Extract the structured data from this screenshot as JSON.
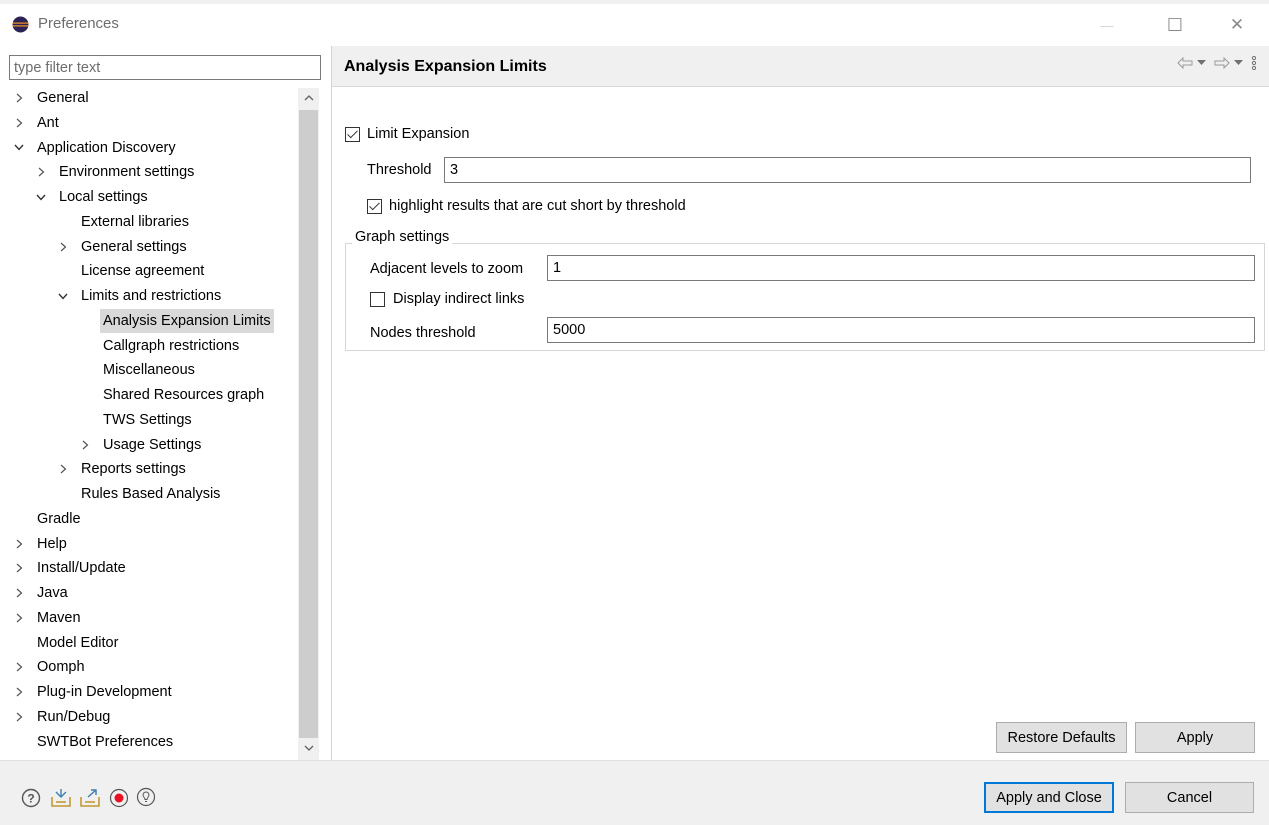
{
  "window": {
    "title": "Preferences",
    "controls": {
      "minimize": "—",
      "maximize": "☐",
      "close": "✕"
    }
  },
  "sidebar": {
    "filter_placeholder": "type filter text",
    "items": [
      {
        "label": "General",
        "level": 0,
        "arrow": "collapsed"
      },
      {
        "label": "Ant",
        "level": 0,
        "arrow": "collapsed"
      },
      {
        "label": "Application Discovery",
        "level": 0,
        "arrow": "expanded"
      },
      {
        "label": "Environment settings",
        "level": 1,
        "arrow": "collapsed"
      },
      {
        "label": "Local settings",
        "level": 1,
        "arrow": "expanded"
      },
      {
        "label": "External libraries",
        "level": 2,
        "arrow": "none"
      },
      {
        "label": "General settings",
        "level": 2,
        "arrow": "collapsed"
      },
      {
        "label": "License agreement",
        "level": 2,
        "arrow": "none"
      },
      {
        "label": "Limits and restrictions",
        "level": 2,
        "arrow": "expanded"
      },
      {
        "label": "Analysis Expansion Limits",
        "level": 3,
        "arrow": "none",
        "selected": true
      },
      {
        "label": "Callgraph restrictions",
        "level": 3,
        "arrow": "none"
      },
      {
        "label": "Miscellaneous",
        "level": 3,
        "arrow": "none"
      },
      {
        "label": "Shared Resources graph",
        "level": 3,
        "arrow": "none"
      },
      {
        "label": "TWS Settings",
        "level": 3,
        "arrow": "none"
      },
      {
        "label": "Usage Settings",
        "level": 3,
        "arrow": "collapsed"
      },
      {
        "label": "Reports settings",
        "level": 2,
        "arrow": "collapsed"
      },
      {
        "label": "Rules Based Analysis",
        "level": 2,
        "arrow": "none"
      },
      {
        "label": "Gradle",
        "level": 0,
        "arrow": "none"
      },
      {
        "label": "Help",
        "level": 0,
        "arrow": "collapsed"
      },
      {
        "label": "Install/Update",
        "level": 0,
        "arrow": "collapsed"
      },
      {
        "label": "Java",
        "level": 0,
        "arrow": "collapsed"
      },
      {
        "label": "Maven",
        "level": 0,
        "arrow": "collapsed"
      },
      {
        "label": "Model Editor",
        "level": 0,
        "arrow": "none"
      },
      {
        "label": "Oomph",
        "level": 0,
        "arrow": "collapsed"
      },
      {
        "label": "Plug-in Development",
        "level": 0,
        "arrow": "collapsed"
      },
      {
        "label": "Run/Debug",
        "level": 0,
        "arrow": "collapsed"
      },
      {
        "label": "SWTBot Preferences",
        "level": 0,
        "arrow": "none"
      }
    ]
  },
  "page": {
    "title": "Analysis Expansion Limits",
    "limit_expansion": {
      "label": "Limit Expansion",
      "checked": true
    },
    "threshold": {
      "label": "Threshold",
      "value": "3"
    },
    "highlight": {
      "label": "highlight results that are cut short by threshold",
      "checked": true
    },
    "graph_settings": {
      "title": "Graph settings",
      "adjacent_levels": {
        "label": "Adjacent levels to zoom",
        "value": "1"
      },
      "display_indirect": {
        "label": "Display indirect links",
        "checked": false
      },
      "nodes_threshold": {
        "label": "Nodes threshold",
        "value": "5000"
      }
    },
    "restore_defaults_label": "Restore Defaults",
    "apply_label": "Apply"
  },
  "footer": {
    "apply_close_label": "Apply and Close",
    "cancel_label": "Cancel",
    "icons": [
      "help-icon",
      "import-icon",
      "export-icon",
      "record-icon",
      "tip-icon"
    ]
  },
  "colors": {
    "accent": "#0078d7",
    "record": "#e81123",
    "selection": "#d9d9d9"
  }
}
